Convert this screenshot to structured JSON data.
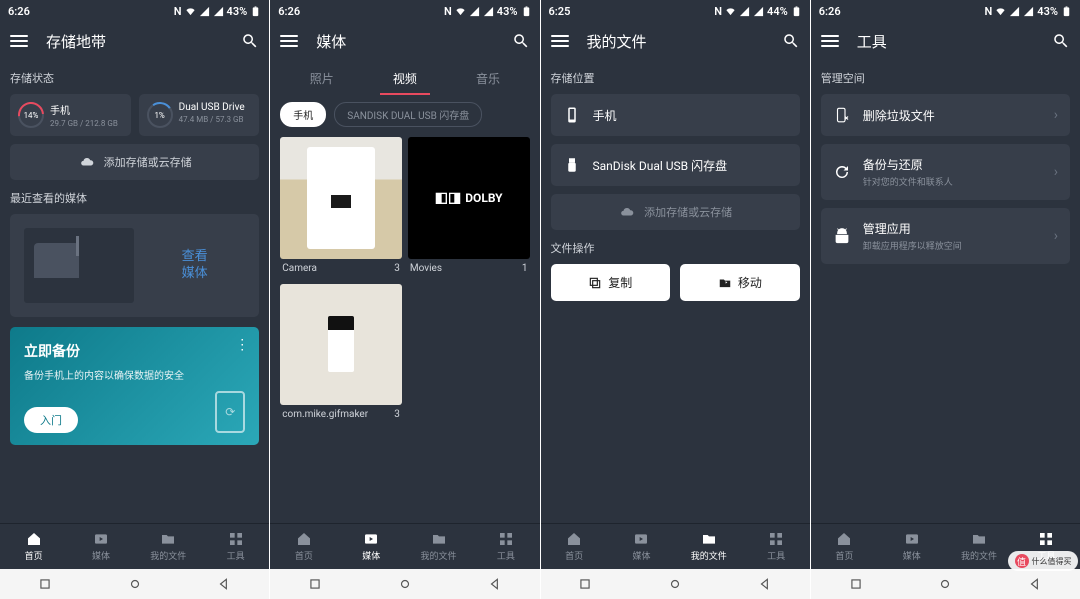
{
  "status": {
    "nfc": "N",
    "battery_suffix": "%"
  },
  "screens": [
    {
      "time": "6:26",
      "battery": "43",
      "title": "存储地带",
      "sections": {
        "storage_state": "存储状态",
        "cards": [
          {
            "pct": "14%",
            "name": "手机",
            "size": "29.7 GB / 212.8 GB",
            "ring": "red"
          },
          {
            "pct": "1%",
            "name": "Dual USB Drive",
            "size": "47.4 MB / 57.3 GB",
            "ring": "tiny"
          }
        ],
        "add_storage": "添加存储或云存储",
        "recent_media": "最近查看的媒体",
        "view_media": "查看\n媒体",
        "backup": {
          "title": "立即备份",
          "desc": "备份手机上的内容以确保数据的安全",
          "cta": "入门"
        }
      },
      "nav_active": 0
    },
    {
      "time": "6:26",
      "battery": "43",
      "title": "媒体",
      "tabs": [
        "照片",
        "视频",
        "音乐"
      ],
      "tab_active": 1,
      "chips": [
        "手机",
        "SANDISK DUAL USB 闪存盘"
      ],
      "chip_active": 0,
      "videos": [
        {
          "name": "Camera",
          "count": "3",
          "thumb": "purifier"
        },
        {
          "name": "Movies",
          "count": "1",
          "thumb": "dolby",
          "dolby_text": "DOLBY"
        },
        {
          "name": "com.mike.gifmaker",
          "count": "3",
          "thumb": "humidifier"
        }
      ],
      "nav_active": 1
    },
    {
      "time": "6:25",
      "battery": "44",
      "title": "我的文件",
      "storage_loc": "存储位置",
      "locations": [
        {
          "icon": "phone",
          "name": "手机"
        },
        {
          "icon": "usb",
          "name": "SanDisk Dual USB 闪存盘"
        }
      ],
      "add_storage": "添加存储或云存储",
      "file_ops": "文件操作",
      "actions": [
        {
          "icon": "copy",
          "label": "复制"
        },
        {
          "icon": "move",
          "label": "移动"
        }
      ],
      "nav_active": 2
    },
    {
      "time": "6:26",
      "battery": "43",
      "title": "工具",
      "manage_space": "管理空间",
      "tools": [
        {
          "icon": "trash",
          "name": "删除垃圾文件",
          "sub": ""
        },
        {
          "icon": "restore",
          "name": "备份与还原",
          "sub": "针对您的文件和联系人"
        },
        {
          "icon": "android",
          "name": "管理应用",
          "sub": "卸载应用程序以释放空间"
        }
      ],
      "nav_active": 3
    }
  ],
  "nav": [
    {
      "icon": "home",
      "label": "首页"
    },
    {
      "icon": "media",
      "label": "媒体"
    },
    {
      "icon": "files",
      "label": "我的文件"
    },
    {
      "icon": "tools",
      "label": "工具"
    }
  ],
  "watermark": "什么值得买"
}
